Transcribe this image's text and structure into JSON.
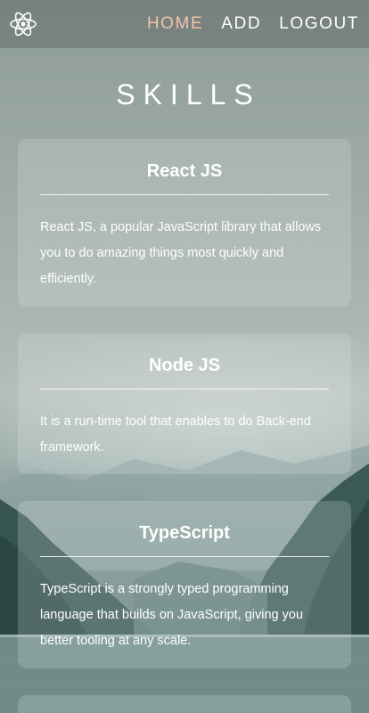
{
  "nav": {
    "logo_icon": "react-atom-icon",
    "links": [
      {
        "label": "HOME",
        "active": true
      },
      {
        "label": "ADD",
        "active": false
      },
      {
        "label": "LOGOUT",
        "active": false
      }
    ],
    "active_color": "#f0c2a8"
  },
  "page": {
    "title": "SKILLS"
  },
  "skills": [
    {
      "title": "React JS",
      "description": "React JS, a popular JavaScript library that allows you to do amazing things most quickly and efficiently."
    },
    {
      "title": "Node JS",
      "description": "It is a run-time tool that enables to do Back-end framework."
    },
    {
      "title": "TypeScript",
      "description": "TypeScript is a strongly typed programming language that builds on JavaScript, giving you better tooling at any scale."
    }
  ]
}
